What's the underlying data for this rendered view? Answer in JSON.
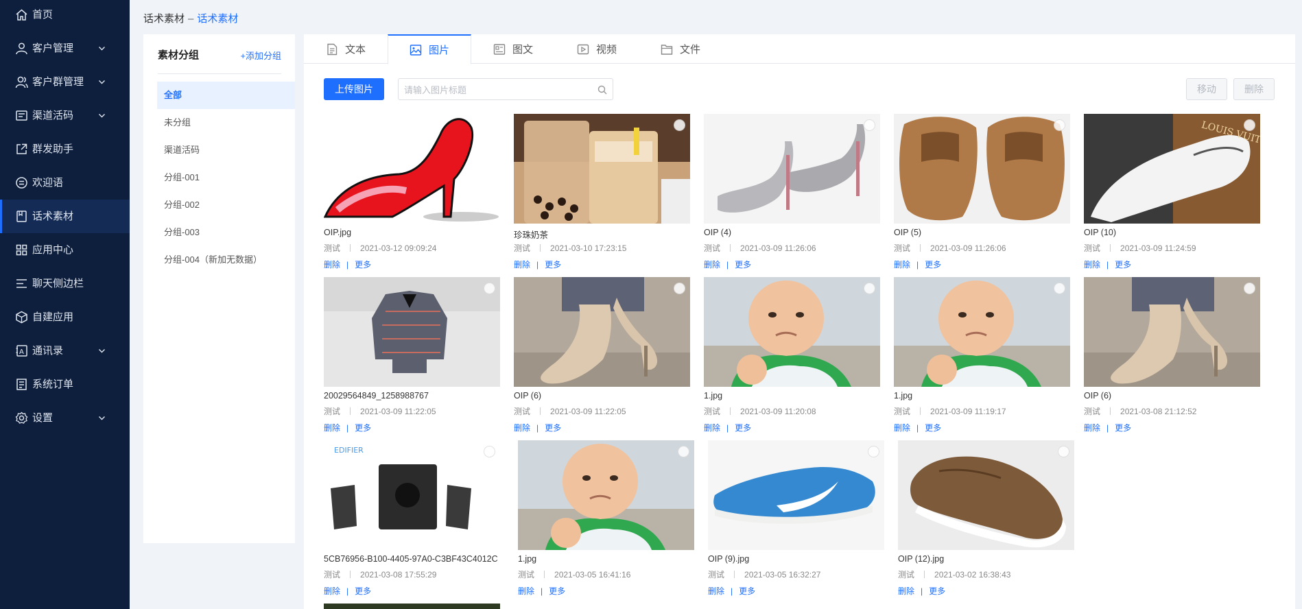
{
  "sidebar": {
    "items": [
      {
        "label": "首页",
        "icon": "home-icon",
        "chevron": false,
        "active": false
      },
      {
        "label": "客户管理",
        "icon": "user-icon",
        "chevron": true,
        "active": false
      },
      {
        "label": "客户群管理",
        "icon": "user-group-icon",
        "chevron": true,
        "active": false
      },
      {
        "label": "渠道活码",
        "icon": "qrcode-icon",
        "chevron": true,
        "active": false
      },
      {
        "label": "群发助手",
        "icon": "share-icon",
        "chevron": false,
        "active": false
      },
      {
        "label": "欢迎语",
        "icon": "message-icon",
        "chevron": false,
        "active": false
      },
      {
        "label": "话术素材",
        "icon": "material-icon",
        "chevron": false,
        "active": true
      },
      {
        "label": "应用中心",
        "icon": "apps-icon",
        "chevron": false,
        "active": false
      },
      {
        "label": "聊天侧边栏",
        "icon": "sidebar-list-icon",
        "chevron": false,
        "active": false
      },
      {
        "label": "自建应用",
        "icon": "cube-icon",
        "chevron": false,
        "active": false
      },
      {
        "label": "通讯录",
        "icon": "contacts-icon",
        "chevron": true,
        "active": false
      },
      {
        "label": "系统订单",
        "icon": "order-icon",
        "chevron": false,
        "active": false
      },
      {
        "label": "设置",
        "icon": "gear-icon",
        "chevron": true,
        "active": false
      }
    ]
  },
  "breadcrumb": {
    "parent": "话术素材",
    "separator": "–",
    "current": "话术素材"
  },
  "groups": {
    "title": "素材分组",
    "add_label": "+添加分组",
    "items": [
      "全部",
      "未分组",
      "渠道活码",
      "分组-001",
      "分组-002",
      "分组-003",
      "分组-004（新加无数据）"
    ],
    "active_index": 0
  },
  "tabs": [
    {
      "label": "文本",
      "icon": "document-icon"
    },
    {
      "label": "图片",
      "icon": "image-icon"
    },
    {
      "label": "图文",
      "icon": "article-icon"
    },
    {
      "label": "视频",
      "icon": "video-icon"
    },
    {
      "label": "文件",
      "icon": "folder-icon"
    }
  ],
  "active_tab": 1,
  "toolbar": {
    "upload_label": "上传图片",
    "search_placeholder": "请输入图片标题",
    "move_label": "移动",
    "delete_label": "删除"
  },
  "card_actions": {
    "delete": "删除",
    "more": "更多"
  },
  "cards": [
    {
      "name": "OIP.jpg",
      "author": "测试",
      "time": "2021-03-12 09:09:24",
      "image": "red-high-heel"
    },
    {
      "name": "珍珠奶茶",
      "author": "测试",
      "time": "2021-03-10 17:23:15",
      "image": "bubble-tea"
    },
    {
      "name": "OIP (4)",
      "author": "测试",
      "time": "2021-03-09 11:26:06",
      "image": "silver-heels"
    },
    {
      "name": "OIP (5)",
      "author": "测试",
      "time": "2021-03-09 11:26:06",
      "image": "brown-brogues"
    },
    {
      "name": "OIP (10)",
      "author": "测试",
      "time": "2021-03-09 11:24:59",
      "image": "white-sneaker"
    },
    {
      "name": "20029564849_1258988767",
      "author": "测试",
      "time": "2021-03-09 11:22:05",
      "image": "jacket"
    },
    {
      "name": "OIP (6)",
      "author": "测试",
      "time": "2021-03-09 11:22:05",
      "image": "beige-heels"
    },
    {
      "name": "1.jpg",
      "author": "测试",
      "time": "2021-03-09 11:20:08",
      "image": "baby-fist"
    },
    {
      "name": "1.jpg",
      "author": "测试",
      "time": "2021-03-09 11:19:17",
      "image": "baby-fist"
    },
    {
      "name": "OIP (6)",
      "author": "测试",
      "time": "2021-03-08 21:12:52",
      "image": "beige-heels"
    },
    {
      "name": "5CB76956-B100-4405-97A0-C3BF43C4012C",
      "author": "测试",
      "time": "2021-03-08 17:55:29",
      "image": "speakers"
    },
    {
      "name": "1.jpg",
      "author": "测试",
      "time": "2021-03-05 16:41:16",
      "image": "baby-fist"
    },
    {
      "name": "OIP (9).jpg",
      "author": "测试",
      "time": "2021-03-05 16:32:27",
      "image": "blue-sneaker"
    },
    {
      "name": "OIP (12).jpg",
      "author": "测试",
      "time": "2021-03-02 16:38:43",
      "image": "brown-boat-shoe"
    }
  ],
  "colors": {
    "accent": "#1f6fff",
    "sidebar_bg": "#0e1f3d",
    "sidebar_active": "#132b55"
  }
}
